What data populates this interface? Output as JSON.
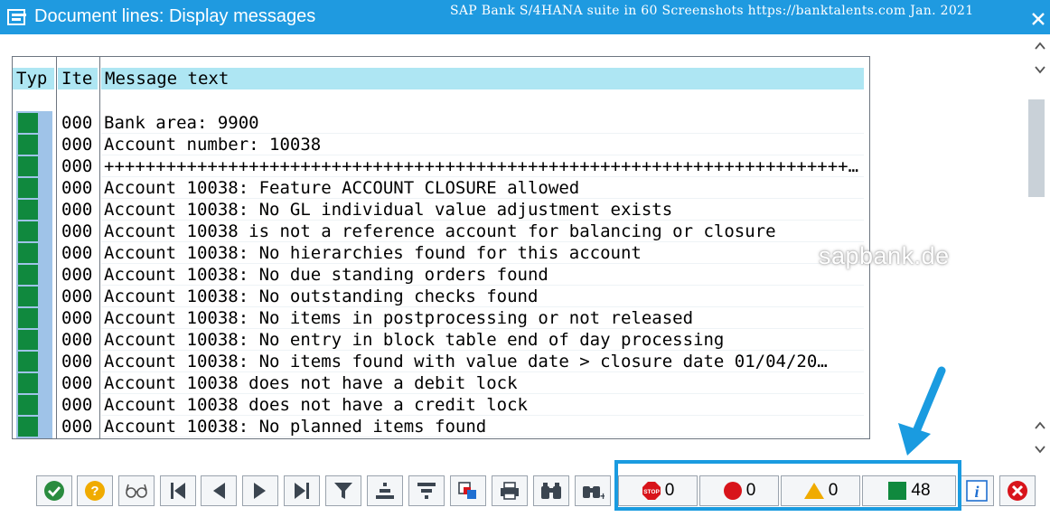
{
  "window": {
    "title": "Document lines: Display messages",
    "credit": "SAP Bank S/4HANA suite in 60 Screenshots  https://banktalents.com Jan. 2021"
  },
  "table": {
    "columns": {
      "type": "Typ",
      "item": "Ite",
      "message": "Message text"
    },
    "rows": [
      {
        "type": "success",
        "item": "000",
        "text": "Bank area: 9900"
      },
      {
        "type": "success",
        "item": "000",
        "text": "Account number: 10038"
      },
      {
        "type": "success",
        "item": "000",
        "text": "+++++++++++++++++++++++++++++++++++++++++++++++++++++++++++++++++++++++++++…"
      },
      {
        "type": "success",
        "item": "000",
        "text": "Account 10038: Feature ACCOUNT CLOSURE allowed"
      },
      {
        "type": "success",
        "item": "000",
        "text": "Account 10038: No GL individual value adjustment exists"
      },
      {
        "type": "success",
        "item": "000",
        "text": "Account 10038 is not a reference account for balancing or closure"
      },
      {
        "type": "success",
        "item": "000",
        "text": "Account 10038: No hierarchies found for this account"
      },
      {
        "type": "success",
        "item": "000",
        "text": "Account 10038: No due standing orders found"
      },
      {
        "type": "success",
        "item": "000",
        "text": "Account 10038: No outstanding checks found"
      },
      {
        "type": "success",
        "item": "000",
        "text": "Account 10038: No items in postprocessing or not released"
      },
      {
        "type": "success",
        "item": "000",
        "text": "Account 10038: No entry in block table end of day processing"
      },
      {
        "type": "success",
        "item": "000",
        "text": "Account 10038: No items found with value date > closure date 01/04/20…"
      },
      {
        "type": "success",
        "item": "000",
        "text": "Account 10038 does not have a debit lock"
      },
      {
        "type": "success",
        "item": "000",
        "text": "Account 10038 does not have a credit lock"
      },
      {
        "type": "success",
        "item": "000",
        "text": "Account 10038: No planned items found"
      }
    ]
  },
  "watermark": "sapbank.de",
  "counters": {
    "abort": "0",
    "error": "0",
    "warning": "0",
    "success": "48"
  },
  "icons": {
    "continue": "check-icon",
    "help": "help-icon",
    "details": "glasses-icon",
    "first": "first-page-icon",
    "previous": "previous-icon",
    "next": "next-icon",
    "last": "last-page-icon",
    "filter": "filter-icon",
    "sort_asc": "sort-ascending-icon",
    "sort_desc": "sort-descending-icon",
    "export": "export-icon",
    "print": "print-icon",
    "find": "find-icon",
    "find_next": "find-next-icon",
    "info": "info-icon",
    "cancel": "cancel-icon"
  },
  "colors": {
    "titlebar": "#1f9ae0",
    "header": "#aee6f3",
    "success": "#10893e",
    "error": "#d8141b",
    "warning": "#f0ab00",
    "highlight": "#1a9be0"
  }
}
